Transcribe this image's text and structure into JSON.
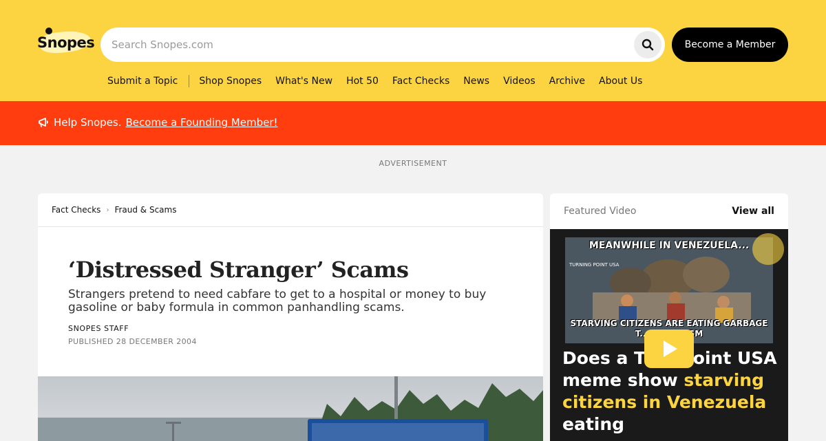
{
  "header": {
    "logo_text": "Snopes",
    "search_placeholder": "Search Snopes.com",
    "member_button": "Become a Member",
    "nav": [
      "Submit a Topic",
      "Shop Snopes",
      "What's New",
      "Hot 50",
      "Fact Checks",
      "News",
      "Videos",
      "Archive",
      "About Us"
    ]
  },
  "promo": {
    "text": "Help Snopes.",
    "link": "Become a Founding Member!"
  },
  "advertisement_label": "ADVERTISEMENT",
  "article": {
    "breadcrumb": [
      "Fact Checks",
      "Fraud & Scams"
    ],
    "title": "‘Distressed Stranger’ Scams",
    "subtitle": "Strangers pretend to need cabfare to get to a hospital or money to buy gasoline or baby formula in common panhandling scams.",
    "author": "SNOPES STAFF",
    "published": "PUBLISHED 28 DECEMBER 2004"
  },
  "featured_video": {
    "heading": "Featured Video",
    "view_all": "View all",
    "meme_top": "MEANWHILE IN VENEZUELA...",
    "meme_logo": "TURNING POINT USA",
    "meme_bottom": "STARVING CITIZENS ARE EATING GARBAGE T... SOCIALISM",
    "question_plain": "Does a Tu    g Point USA meme show ",
    "question_highlight": "starving citizens in Venezuela",
    "question_end": " eating"
  },
  "colors": {
    "brand_yellow": "#fcd441",
    "promo_orange": "#ff3d0f",
    "background": "#f2f2f2"
  }
}
